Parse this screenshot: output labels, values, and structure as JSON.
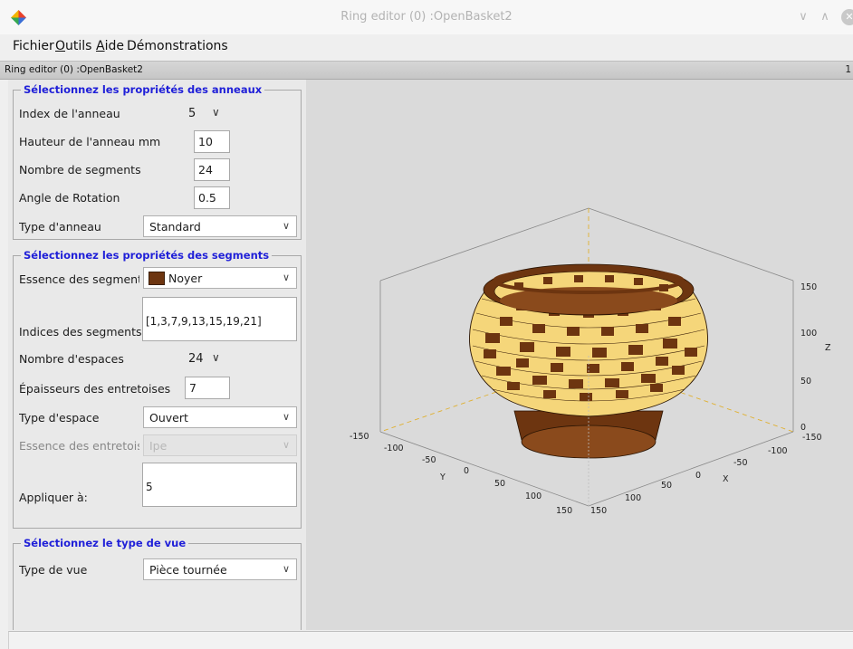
{
  "window": {
    "title": "Ring editor (0) :OpenBasket2",
    "controls": {
      "minimize": "∨",
      "maximize": "∧",
      "close": "✕"
    }
  },
  "menu": [
    {
      "label": "Fichier",
      "mnemonic_pre": "",
      "mnemonic": "",
      "mnemonic_post": ""
    },
    {
      "label": "Outils",
      "mnemonic_pre": "",
      "mnemonic": "O",
      "mnemonic_post": "utils"
    },
    {
      "label": "Aide",
      "mnemonic_pre": "",
      "mnemonic": "A",
      "mnemonic_post": "ide"
    },
    {
      "label": "Démonstrations",
      "mnemonic_pre": "",
      "mnemonic": "",
      "mnemonic_post": ""
    }
  ],
  "inner_window": {
    "title": "Ring editor (0) :OpenBasket2",
    "right_marker": "1"
  },
  "ring_group": {
    "title": "Sélectionnez les propriétés des anneaux",
    "ring_index_label": "Index de l'anneau",
    "ring_index_value": "5",
    "ring_height_label": "Hauteur de l'anneau mm",
    "ring_height_value": "10",
    "segment_count_label": "Nombre de segments",
    "segment_count_value": "24",
    "rotation_label": "Angle de Rotation",
    "rotation_value": "0.5",
    "ring_type_label": "Type d'anneau",
    "ring_type_value": "Standard"
  },
  "segment_group": {
    "title": "Sélectionnez les propriétés des segments",
    "wood_label": "Essence des segments",
    "wood_value": "Noyer",
    "wood_color": "#6d3510",
    "indices_label": "Indices des segments",
    "indices_value": "[1,3,7,9,13,15,19,21]",
    "gap_count_label": "Nombre d'espaces",
    "gap_count_value": "24",
    "spacer_thickness_label": "Épaisseurs des entretoises",
    "spacer_thickness_value": "7",
    "gap_type_label": "Type d'espace",
    "gap_type_value": "Ouvert",
    "spacer_wood_label": "Essence des entretoises",
    "spacer_wood_value": "Ipe",
    "apply_label": "Appliquer à:",
    "apply_value": "5"
  },
  "view_group": {
    "title": "Sélectionnez le type de vue",
    "view_type_label": "Type de vue",
    "view_type_value": "Pièce tournée"
  },
  "plot": {
    "z_axis_title": "Z",
    "x_axis_title": "X",
    "y_axis_title": "Y",
    "z_ticks": [
      "150",
      "100",
      "50",
      "0"
    ],
    "x_ticks": [
      "-150",
      "-100",
      "-50",
      "0",
      "50",
      "100",
      "150"
    ],
    "y_ticks": [
      "-150",
      "-100",
      "-50",
      "0",
      "50",
      "100",
      "150"
    ],
    "colors": {
      "walnut": "#6d3510",
      "light_wood": "#f5d67a",
      "axis_dash": "#e0b030"
    }
  }
}
